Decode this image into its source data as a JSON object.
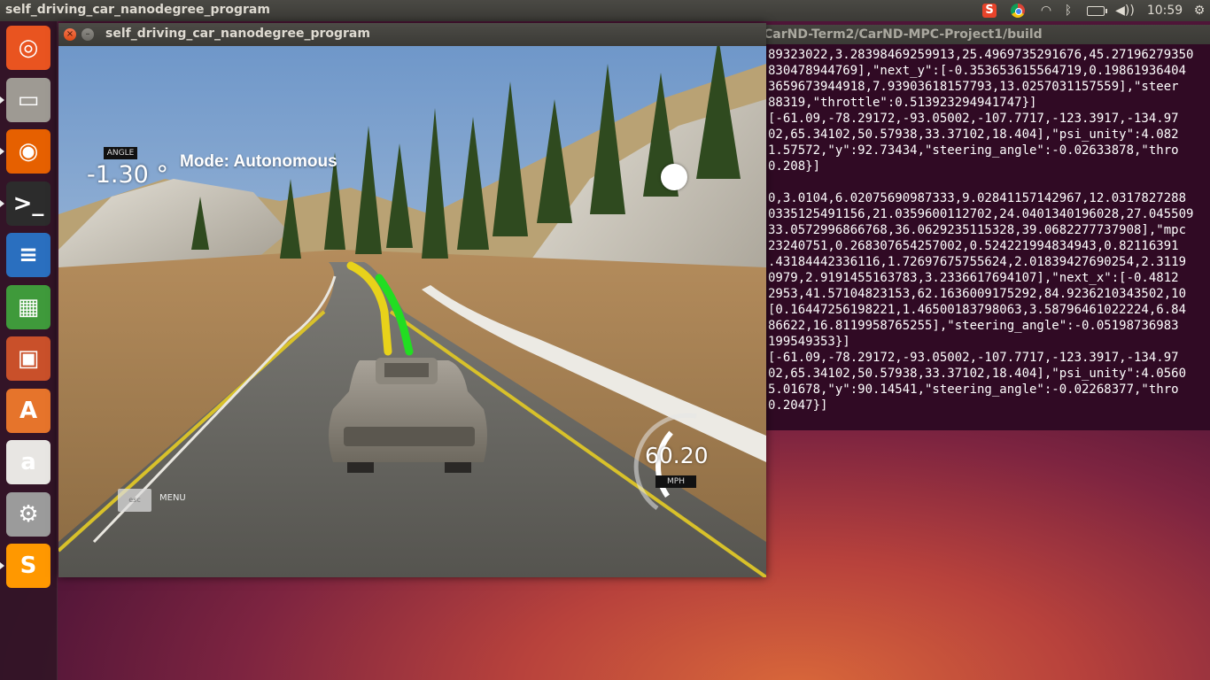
{
  "top_panel": {
    "active_app": "self_driving_car_nanodegree_program",
    "clock": "10:59",
    "tray_icons": [
      "sogou-icon",
      "chrome-icon",
      "wifi-icon",
      "bluetooth-icon",
      "battery-icon",
      "volume-icon",
      "settings-gear-icon"
    ],
    "sogou_glyph": "S",
    "wifi_glyph": "◠",
    "bluetooth_glyph": "ᛒ",
    "volume_glyph": "◀))",
    "gear_glyph": "⚙"
  },
  "launcher": {
    "items": [
      {
        "name": "ubuntu-dash",
        "glyph": "◎",
        "color": "#e95420"
      },
      {
        "name": "files",
        "glyph": "▭",
        "color": "#9e9a93"
      },
      {
        "name": "firefox",
        "glyph": "◉",
        "color": "#e66000"
      },
      {
        "name": "terminal",
        "glyph": ">_",
        "color": "#2c2c2c"
      },
      {
        "name": "libreoffice-writer",
        "glyph": "≡",
        "color": "#2a6fbf"
      },
      {
        "name": "libreoffice-calc",
        "glyph": "▦",
        "color": "#3f9a3b"
      },
      {
        "name": "libreoffice-impress",
        "glyph": "▣",
        "color": "#c9502a"
      },
      {
        "name": "ubuntu-software",
        "glyph": "A",
        "color": "#e6742b"
      },
      {
        "name": "amazon",
        "glyph": "a",
        "color": "#e8e6e3"
      },
      {
        "name": "system-settings",
        "glyph": "⚙",
        "color": "#9b9b9b"
      },
      {
        "name": "sublime-text",
        "glyph": "S",
        "color": "#ff9800"
      }
    ]
  },
  "terminal": {
    "title": "CarND-Term2/CarND-MPC-Project1/build",
    "lines": [
      "89323022,3.28398469259913,25.4969735291676,45.27196279350",
      "830478944769],\"next_y\":[-0.353653615564719,0.19861936404",
      "3659673944918,7.93903618157793,13.0257031157559],\"steer",
      "88319,\"throttle\":0.513923294941747}]",
      "[-61.09,-78.29172,-93.05002,-107.7717,-123.3917,-134.97",
      "02,65.34102,50.57938,33.37102,18.404],\"psi_unity\":4.082",
      "1.57572,\"y\":92.73434,\"steering_angle\":-0.02633878,\"thro",
      "0.208}]",
      "",
      "0,3.0104,6.02075690987333,9.02841157142967,12.0317827288",
      "0335125491156,21.0359600112702,24.0401340196028,27.045509",
      "33.0572996866768,36.0629235115328,39.0682277737908],\"mpc",
      "23240751,0.268307654257002,0.524221994834943,0.82116391",
      ".43184442336116,1.72697675755624,2.01839427690254,2.3119",
      "0979,2.9191455163783,3.2336617694107],\"next_x\":[-0.4812",
      "2953,41.57104823153,62.1636009175292,84.9236210343502,10",
      "[0.16447256198221,1.46500183798063,3.58796461022224,6.84",
      "86622,16.8119958765255],\"steering_angle\":-0.05198736983",
      "199549353}]",
      "[-61.09,-78.29172,-93.05002,-107.7717,-123.3917,-134.97",
      "02,65.34102,50.57938,33.37102,18.404],\"psi_unity\":4.0560",
      "5.01678,\"y\":90.14541,\"steering_angle\":-0.02268377,\"thro",
      "0.2047}]"
    ]
  },
  "simulator": {
    "title": "self_driving_car_nanodegree_program",
    "close_glyph": "×",
    "minimize_glyph": "–",
    "hud": {
      "angle_label": "ANGLE",
      "angle_value": "-1.30 °",
      "mode": "Mode: Autonomous",
      "speed_value": "60.20",
      "speed_unit": "MPH",
      "esc_label": "esc",
      "menu_label": "MENU",
      "speed_gauge_fraction": 0.45
    },
    "colors": {
      "sky": "#8fb2d8",
      "road": "#6b6b66",
      "reference_line": "#e8d21a",
      "waypoints_line": "#22dd22",
      "lane_yellow": "#d8c12a"
    }
  }
}
